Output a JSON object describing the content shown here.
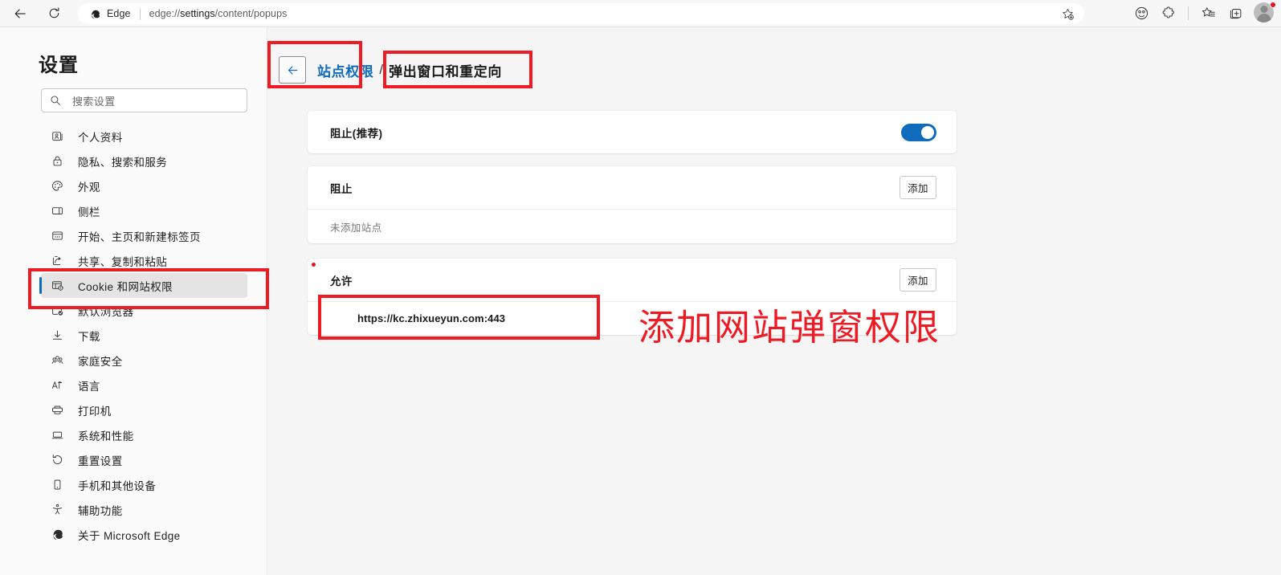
{
  "browser": {
    "nav": {
      "back_label": "back-arrow",
      "reload_label": "reload"
    },
    "omnibox": {
      "brand": "Edge",
      "url_prefix": "edge://",
      "url_bold": "settings",
      "url_suffix": "/content/popups",
      "url_full": "edge://settings/content/popups"
    },
    "toolbar_icons": [
      {
        "name": "add-favorite-icon"
      },
      {
        "name": "browser-essentials-icon"
      },
      {
        "name": "extensions-icon"
      },
      {
        "name": "favorites-icon"
      },
      {
        "name": "collections-icon"
      },
      {
        "name": "profile-avatar"
      }
    ]
  },
  "sidebar": {
    "title": "设置",
    "search": {
      "placeholder": "搜索设置",
      "value": "",
      "icon": "search-icon"
    },
    "items": [
      {
        "label": "个人资料",
        "icon": "profile-card-icon",
        "selected": false
      },
      {
        "label": "隐私、搜索和服务",
        "icon": "lock-icon",
        "selected": false
      },
      {
        "label": "外观",
        "icon": "palette-icon",
        "selected": false
      },
      {
        "label": "侧栏",
        "icon": "sidebar-panel-icon",
        "selected": false
      },
      {
        "label": "开始、主页和新建标签页",
        "icon": "new-tab-page-icon",
        "selected": false
      },
      {
        "label": "共享、复制和粘贴",
        "icon": "share-icon",
        "selected": false
      },
      {
        "label": "Cookie 和网站权限",
        "icon": "cookie-settings-icon",
        "selected": true
      },
      {
        "label": "默认浏览器",
        "icon": "default-browser-icon",
        "selected": false
      },
      {
        "label": "下载",
        "icon": "download-icon",
        "selected": false
      },
      {
        "label": "家庭安全",
        "icon": "family-safety-icon",
        "selected": false
      },
      {
        "label": "语言",
        "icon": "language-icon",
        "selected": false
      },
      {
        "label": "打印机",
        "icon": "printer-icon",
        "selected": false
      },
      {
        "label": "系统和性能",
        "icon": "laptop-icon",
        "selected": false
      },
      {
        "label": "重置设置",
        "icon": "reset-icon",
        "selected": false
      },
      {
        "label": "手机和其他设备",
        "icon": "phone-icon",
        "selected": false
      },
      {
        "label": "辅助功能",
        "icon": "accessibility-icon",
        "selected": false
      },
      {
        "label": "关于 Microsoft Edge",
        "icon": "edge-logo-icon",
        "selected": false
      }
    ]
  },
  "main": {
    "breadcrumb": {
      "back_icon": "back-arrow-icon",
      "parent": "站点权限",
      "separator": "/",
      "current": "弹出窗口和重定向"
    },
    "block_toggle_card": {
      "label": "阻止(推荐)",
      "toggle_on": true
    },
    "block_card": {
      "title": "阻止",
      "add_label": "添加",
      "empty_text": "未添加站点",
      "sites": []
    },
    "allow_card": {
      "title": "允许",
      "add_label": "添加",
      "sites": [
        {
          "url": "https://kc.zhixueyun.com:443"
        }
      ]
    }
  },
  "annotations": {
    "color": "#ee1b24",
    "callout_text": "添加网站弹窗权限",
    "boxes": [
      {
        "name": "sidebar-cookie-highlight"
      },
      {
        "name": "breadcrumb-back-highlight"
      },
      {
        "name": "breadcrumb-current-highlight"
      },
      {
        "name": "allowed-site-highlight"
      }
    ]
  }
}
